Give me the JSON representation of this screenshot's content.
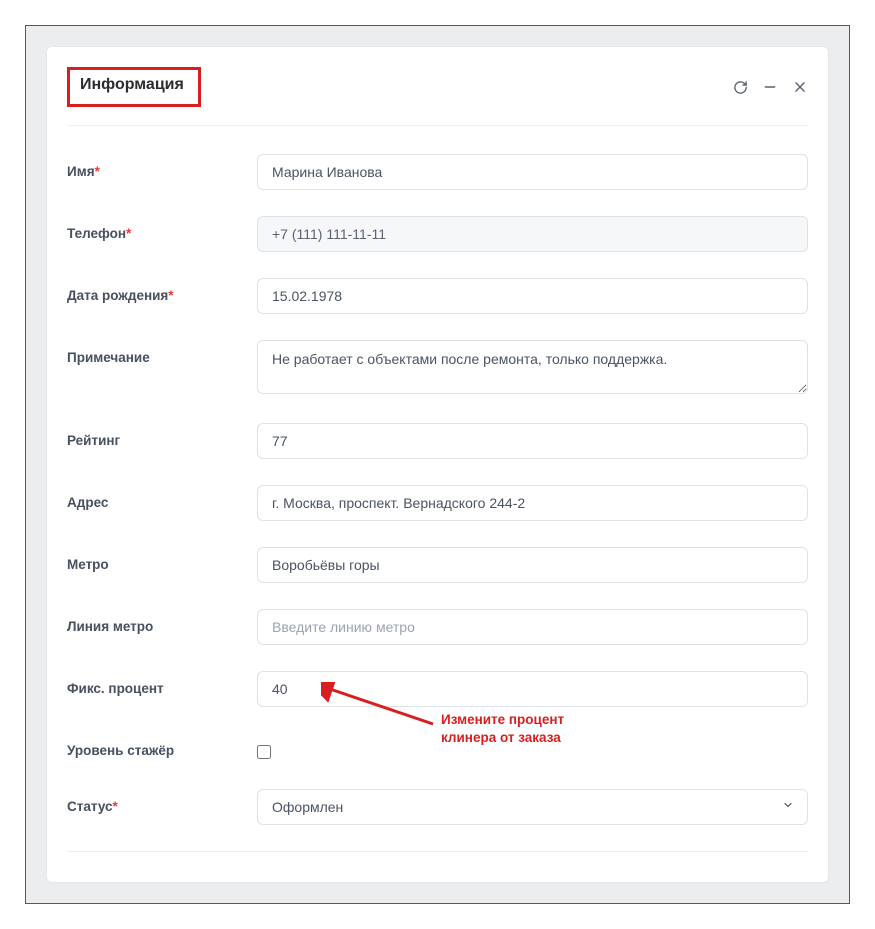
{
  "panel": {
    "title": "Информация"
  },
  "form": {
    "name": {
      "label": "Имя",
      "required": true,
      "value": "Марина Иванова"
    },
    "phone": {
      "label": "Телефон",
      "required": true,
      "value": "+7 (111) 111-11-11"
    },
    "dob": {
      "label": "Дата рождения",
      "required": true,
      "value": "15.02.1978"
    },
    "note": {
      "label": "Примечание",
      "value": "Не работает с объектами после ремонта, только поддержка."
    },
    "rating": {
      "label": "Рейтинг",
      "value": "77"
    },
    "address": {
      "label": "Адрес",
      "value": "г. Москва, проспект. Вернадского 244-2"
    },
    "metro": {
      "label": "Метро",
      "value": "Воробьёвы горы"
    },
    "metro_line": {
      "label": "Линия метро",
      "placeholder": "Введите линию метро",
      "value": ""
    },
    "fixed_percent": {
      "label": "Фикс. процент",
      "value": "40"
    },
    "trainee": {
      "label": "Уровень стажёр",
      "checked": false
    },
    "status": {
      "label": "Статус",
      "required": true,
      "value": "Оформлен"
    }
  },
  "annotation": {
    "line1": "Измените процент",
    "line2": "клинера от заказа"
  }
}
